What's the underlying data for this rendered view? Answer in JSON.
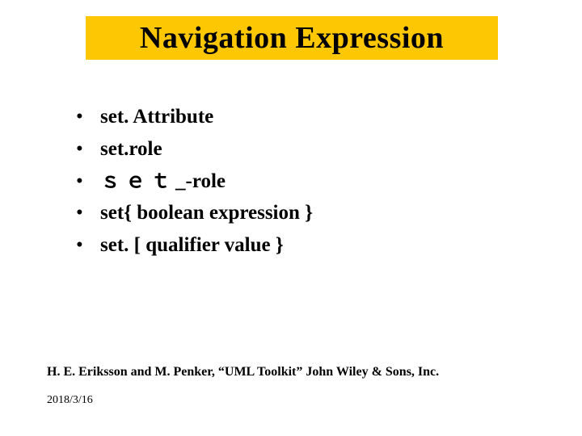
{
  "title": "Navigation Expression",
  "bullets": [
    {
      "text": "set. Attribute"
    },
    {
      "text_pre": "set.",
      "text_mid": "role"
    },
    {
      "text_wide": "ｓｅｔ",
      "text_rest": "_-role"
    },
    {
      "text": "set{  boolean expression }"
    },
    {
      "text": "set. [ qualifier value }"
    }
  ],
  "footer": "H. E. Eriksson and M. Penker, “UML Toolkit” John Wiley & Sons, Inc.",
  "date": "2018/3/16"
}
